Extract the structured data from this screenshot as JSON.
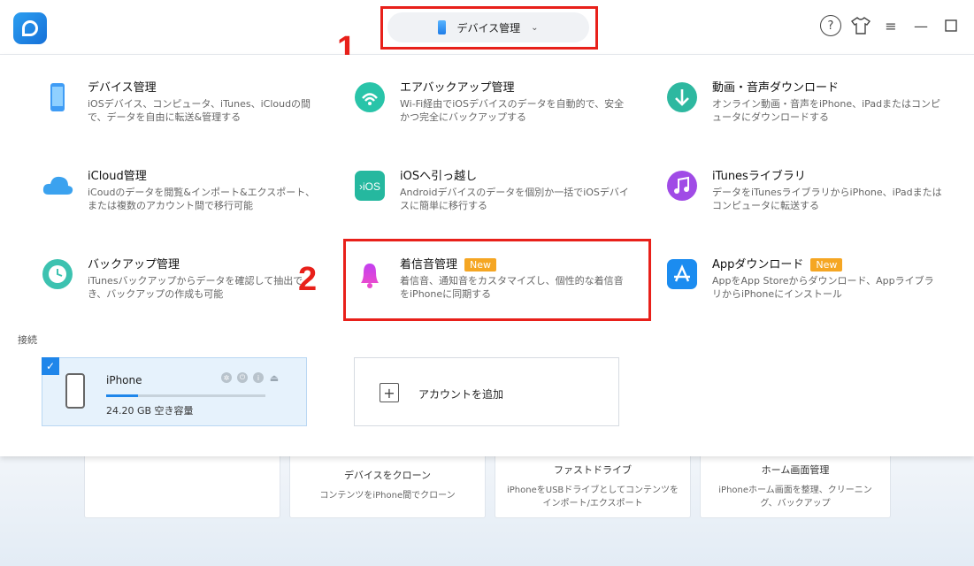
{
  "topbar": {
    "device_selector": "デバイス管理",
    "annotation_1": "1"
  },
  "features": [
    {
      "title": "デバイス管理",
      "desc": "iOSデバイス、コンピュータ、iTunes、iCloudの間で、データを自由に転送&管理する",
      "icon": "phone-icon"
    },
    {
      "title": "エアバックアップ管理",
      "desc": "Wi-Fi経由でiOSデバイスのデータを自動的で、安全かつ完全にバックアップする",
      "icon": "wifi-backup-icon"
    },
    {
      "title": "動画・音声ダウンロード",
      "desc": "オンライン動画・音声をiPhone、iPadまたはコンピュータにダウンロードする",
      "icon": "download-icon"
    },
    {
      "title": "iCloud管理",
      "desc": "iCoudのデータを閲覧&インポート&エクスポート、または複数のアカウント間で移行可能",
      "icon": "cloud-icon"
    },
    {
      "title": "iOSへ引っ越し",
      "desc": "Androidデバイスのデータを個別か一括でiOSデバイスに簡単に移行する",
      "icon": "to-ios-icon"
    },
    {
      "title": "iTunesライブラリ",
      "desc": "データをiTunesライブラリからiPhone、iPadまたはコンピュータに転送する",
      "icon": "music-icon"
    },
    {
      "title": "バックアップ管理",
      "desc": "iTunesバックアップからデータを確認して抽出でき、バックアップの作成も可能",
      "icon": "backup-clock-icon"
    },
    {
      "title": "着信音管理",
      "badge": "New",
      "desc": "着信音、通知音をカスタマイズし、個性的な着信音をiPhoneに同期する",
      "icon": "bell-icon"
    },
    {
      "title": "Appダウンロード",
      "badge": "New",
      "desc": "AppをApp Storeからダウンロード、AppライブラリからiPhoneにインストール",
      "icon": "app-store-icon"
    }
  ],
  "annotation_2": "2",
  "connection": {
    "label": "接続",
    "device_name": "iPhone",
    "capacity": "24.20 GB 空き容量",
    "storage_used_fraction": 0.2,
    "add_account": "アカウントを追加"
  },
  "background_cards": [
    {
      "title": "",
      "desc": ""
    },
    {
      "title": "デバイスをクローン",
      "desc": "コンテンツをiPhone間でクローン"
    },
    {
      "title": "ファストドライブ",
      "desc": "iPhoneをUSBドライブとしてコンテンツをインポート/エクスポート"
    },
    {
      "title": "ホーム画面管理",
      "desc": "iPhoneホーム画面を整理、クリーニング、バックアップ"
    }
  ],
  "colors": {
    "accent": "#1f86ea",
    "highlight": "#e8201a",
    "badge": "#f5a623"
  }
}
